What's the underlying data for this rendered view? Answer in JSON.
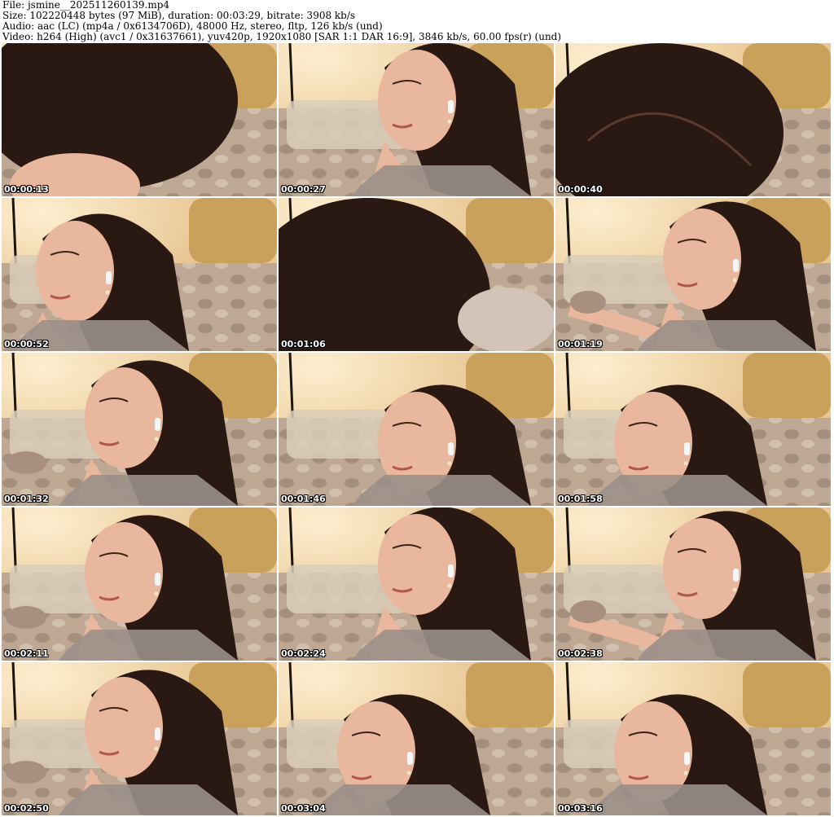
{
  "header": {
    "file_line": "File: jsmine__202511260139.mp4",
    "size_line": "Size: 102220448 bytes (97 MiB), duration: 00:03:29, bitrate: 3908 kb/s",
    "audio_line": "Audio: aac (LC) (mp4a / 0x6134706D), 48000 Hz, stereo, fltp, 126 kb/s (und)",
    "video_line": "Video: h264 (High) (avc1 / 0x31637661), yuv420p, 1920x1080 [SAR 1:1 DAR 16:9], 3846 kb/s, 60.00 fps(r) (und)"
  },
  "thumbnails": [
    {
      "timestamp": "00:00:13",
      "scene": "hair-closeup-left"
    },
    {
      "timestamp": "00:00:27",
      "scene": "face-earbud"
    },
    {
      "timestamp": "00:00:40",
      "scene": "hair-top"
    },
    {
      "timestamp": "00:00:52",
      "scene": "profile-left-close"
    },
    {
      "timestamp": "00:01:06",
      "scene": "hair-blur"
    },
    {
      "timestamp": "00:01:19",
      "scene": "face-arm-reach"
    },
    {
      "timestamp": "00:01:32",
      "scene": "profile-left"
    },
    {
      "timestamp": "00:01:46",
      "scene": "profile-smile"
    },
    {
      "timestamp": "00:01:58",
      "scene": "looking-down"
    },
    {
      "timestamp": "00:02:11",
      "scene": "profile-left"
    },
    {
      "timestamp": "00:02:24",
      "scene": "face-talking"
    },
    {
      "timestamp": "00:02:38",
      "scene": "face-arm-reach"
    },
    {
      "timestamp": "00:02:50",
      "scene": "profile-left"
    },
    {
      "timestamp": "00:03:04",
      "scene": "looking-down"
    },
    {
      "timestamp": "00:03:16",
      "scene": "looking-down"
    }
  ],
  "colors": {
    "wall": "#e9c795",
    "pillow": "#c9a15a",
    "bedding": "#bfa893",
    "hair": "#2a1812",
    "skin": "#e9b79d",
    "timestamp_text": "#ffffff"
  }
}
